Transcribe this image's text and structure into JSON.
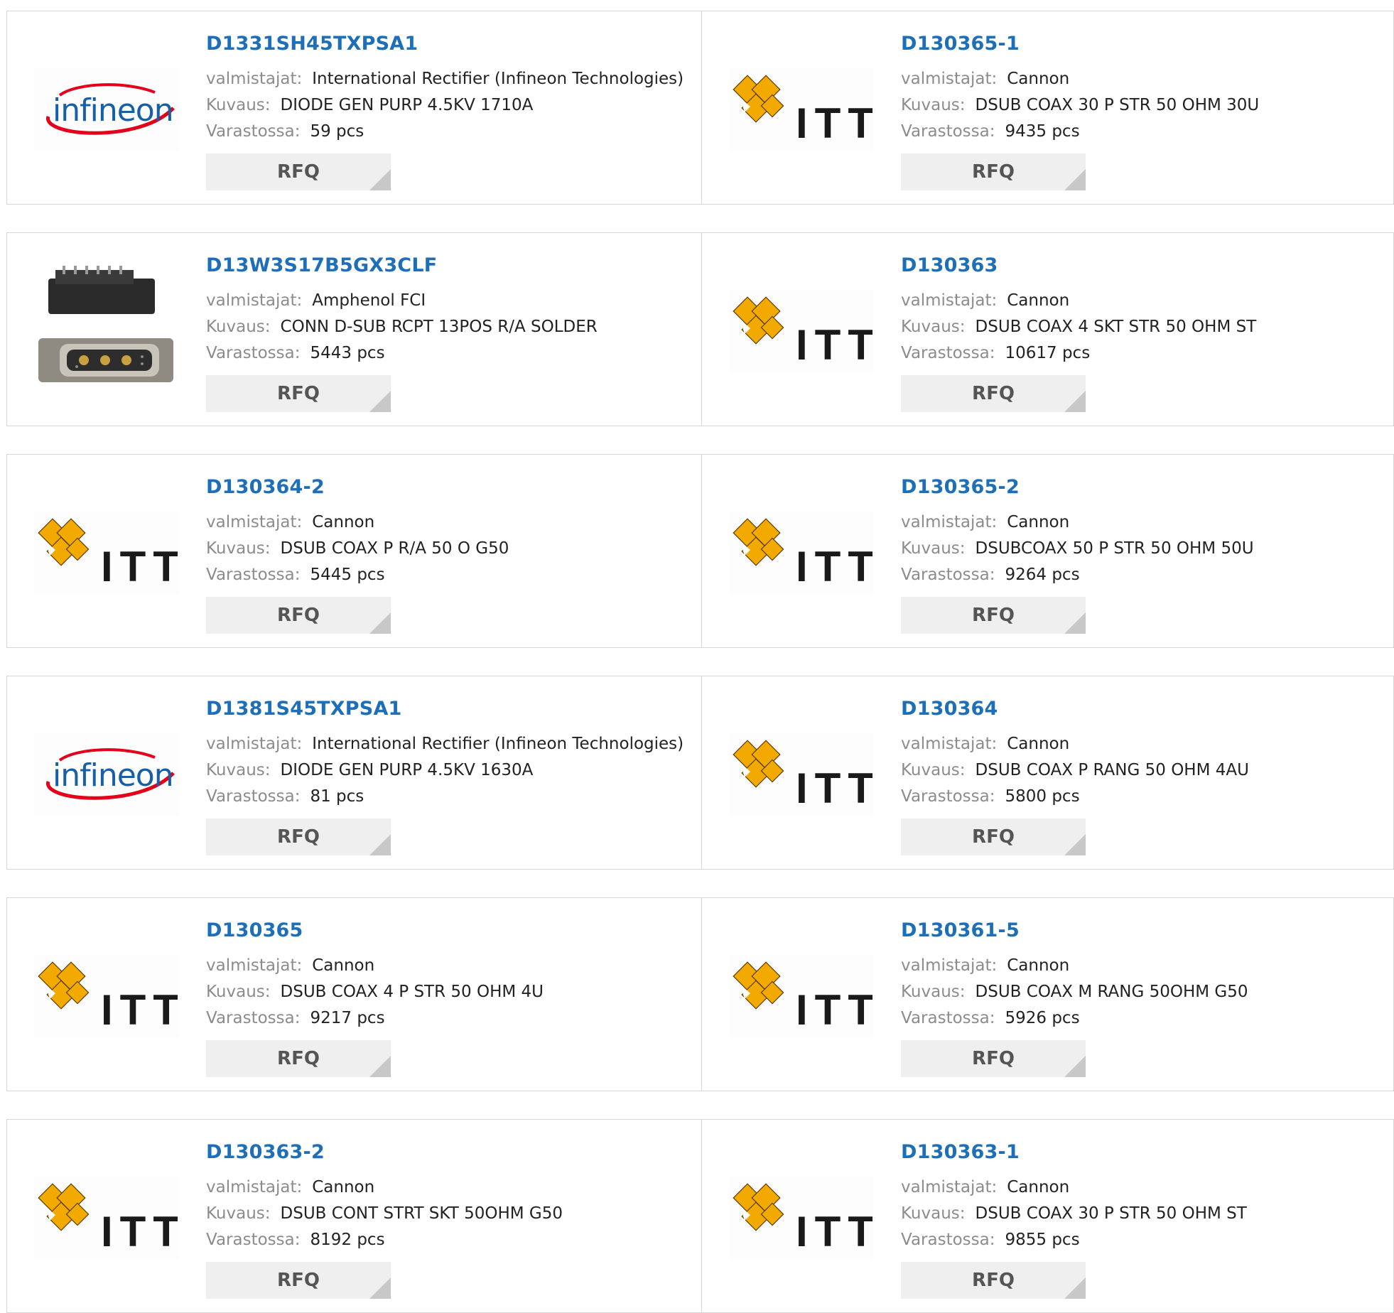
{
  "labels": {
    "manufacturer": "valmistajat:",
    "description": "Kuvaus:",
    "stock": "Varastossa:",
    "rfq": "RFQ"
  },
  "logos": {
    "infineon": "infineon",
    "itt": "ITT"
  },
  "colors": {
    "part_link": "#1e6fb8",
    "label_gray": "#8c8c8c",
    "button_bg": "#efefef",
    "border": "#d4d4d4",
    "itt_orange": "#f2a900",
    "infineon_blue": "#1760a8",
    "infineon_red": "#e2001a"
  },
  "rows": [
    [
      {
        "part": "D1331SH45TXPSA1",
        "manufacturer": "International Rectifier (Infineon Technologies)",
        "description": "DIODE GEN PURP 4.5KV 1710A",
        "stock": "59 pcs",
        "logo": "infineon"
      },
      {
        "part": "D130365-1",
        "manufacturer": "Cannon",
        "description": "DSUB COAX 30 P STR 50 OHM 30U",
        "stock": "9435 pcs",
        "logo": "itt"
      }
    ],
    [
      {
        "part": "D13W3S17B5GX3CLF",
        "manufacturer": "Amphenol FCI",
        "description": "CONN D-SUB RCPT 13POS R/A SOLDER",
        "stock": "5443 pcs",
        "logo": "connector-photo"
      },
      {
        "part": "D130363",
        "manufacturer": "Cannon",
        "description": "DSUB COAX 4 SKT STR 50 OHM ST",
        "stock": "10617 pcs",
        "logo": "itt"
      }
    ],
    [
      {
        "part": "D130364-2",
        "manufacturer": "Cannon",
        "description": "DSUB COAX P R/A 50 O G50",
        "stock": "5445 pcs",
        "logo": "itt"
      },
      {
        "part": "D130365-2",
        "manufacturer": "Cannon",
        "description": "DSUBCOAX 50 P STR 50 OHM 50U",
        "stock": "9264 pcs",
        "logo": "itt"
      }
    ],
    [
      {
        "part": "D1381S45TXPSA1",
        "manufacturer": "International Rectifier (Infineon Technologies)",
        "description": "DIODE GEN PURP 4.5KV 1630A",
        "stock": "81 pcs",
        "logo": "infineon"
      },
      {
        "part": "D130364",
        "manufacturer": "Cannon",
        "description": "DSUB COAX P RANG 50 OHM 4AU",
        "stock": "5800 pcs",
        "logo": "itt"
      }
    ],
    [
      {
        "part": "D130365",
        "manufacturer": "Cannon",
        "description": "DSUB COAX 4 P STR 50 OHM 4U",
        "stock": "9217 pcs",
        "logo": "itt"
      },
      {
        "part": "D130361-5",
        "manufacturer": "Cannon",
        "description": "DSUB COAX M RANG 50OHM G50",
        "stock": "5926 pcs",
        "logo": "itt"
      }
    ],
    [
      {
        "part": "D130363-2",
        "manufacturer": "Cannon",
        "description": "DSUB CONT STRT SKT 50OHM G50",
        "stock": "8192 pcs",
        "logo": "itt"
      },
      {
        "part": "D130363-1",
        "manufacturer": "Cannon",
        "description": "DSUB COAX 30 P STR 50 OHM ST",
        "stock": "9855 pcs",
        "logo": "itt"
      }
    ]
  ]
}
